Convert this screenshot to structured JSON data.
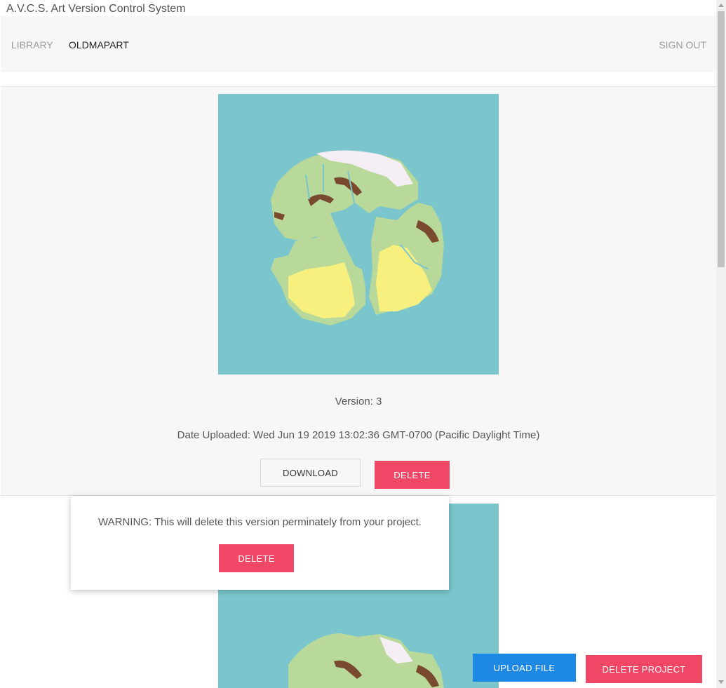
{
  "window": {
    "title": "A.V.C.S. Art Version Control System"
  },
  "nav": {
    "library": "LIBRARY",
    "project": "OLDMAPART",
    "sign_out": "SIGN OUT"
  },
  "versions": [
    {
      "version_text": "Version: 3",
      "date_text": "Date Uploaded: Wed Jun 19 2019 13:02:36 GMT-0700 (Pacific Daylight Time)",
      "download_label": "DOWNLOAD",
      "delete_label": "DELETE"
    }
  ],
  "popover": {
    "warning": "WARNING: This will delete this version perminately from your project.",
    "confirm_label": "DELETE"
  },
  "actions": {
    "upload_label": "UPLOAD FILE",
    "delete_project_label": "DELETE PROJECT"
  },
  "colors": {
    "ocean": "#7ac6cc",
    "land": "#b9d99b",
    "sand": "#f7ef7e",
    "mountains": "#7a4a2f",
    "snow": "#f5eef4",
    "delete": "#ef4765",
    "upload": "#1e88e5"
  }
}
